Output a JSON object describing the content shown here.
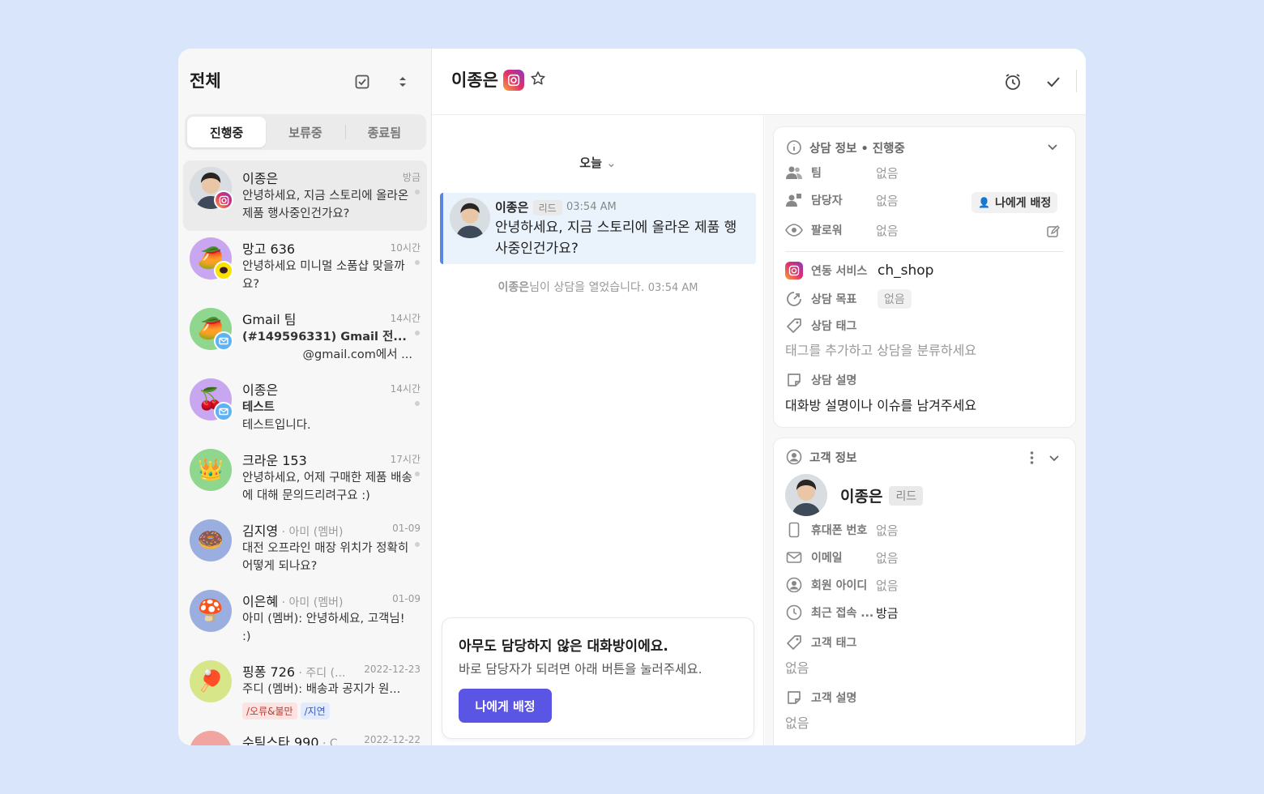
{
  "sidebar": {
    "title": "전체",
    "tabs": [
      "진행중",
      "보류중",
      "종료됨"
    ],
    "items": [
      {
        "name": "이종은",
        "sub": "",
        "time": "방금",
        "msg": "안녕하세요, 지금 스토리에 올라온 제품 행사중인건가요?",
        "avatar": "🧑",
        "channel": "instagram",
        "tags": []
      },
      {
        "name": "망고 636",
        "sub": "",
        "time": "10시간",
        "msg": "안녕하세요 미니멀 소품샵 맞을까요?",
        "avatar": "🥭",
        "channel": "kakao",
        "tags": []
      },
      {
        "name": "Gmail 팀",
        "sub": "",
        "time": "14시간",
        "msg_bold": "(#149596331) Gmail 전...",
        "msg": "@gmail.com에서 ...",
        "avatar": "🥭",
        "channel": "email",
        "tags": []
      },
      {
        "name": "이종은",
        "sub": "",
        "time": "14시간",
        "msg_bold": "테스트",
        "msg": "테스트입니다.",
        "avatar": "🍒",
        "channel": "email",
        "tags": []
      },
      {
        "name": "크라운 153",
        "sub": "",
        "time": "17시간",
        "msg": "안녕하세요, 어제 구매한 제품 배송에 대해 문의드리려구요 :)",
        "avatar": "👑",
        "channel": "",
        "tags": []
      },
      {
        "name": "김지영",
        "sub": " · 아미 (멤버)",
        "time": "01-09",
        "msg": "대전 오프라인 매장 위치가 정확히 어떻게 되나요?",
        "avatar": "🍩",
        "channel": "",
        "tags": []
      },
      {
        "name": "이은혜",
        "sub": " · 아미 (멤버)",
        "time": "01-09",
        "msg": "아미 (멤버): 안녕하세요, 고객님! :)",
        "avatar": "🍄",
        "channel": "",
        "tags": []
      },
      {
        "name": "핑퐁 726",
        "sub": " · 주디 (...",
        "time": "2022-12-23",
        "msg": "주디 (멤버): 배송과 공지가 원...",
        "avatar": "🏓",
        "channel": "",
        "tags": [
          "/오류&불만",
          "/지연"
        ]
      },
      {
        "name": "수틱스타 990",
        "sub": " · C...",
        "time": "2022-12-22",
        "msg": "",
        "avatar": "",
        "channel": "",
        "tags": []
      }
    ]
  },
  "header": {
    "name": "이종은"
  },
  "chat": {
    "date_label": "오늘",
    "message": {
      "author": "이종은",
      "role": "리드",
      "time": "03:54 AM",
      "text": "안녕하세요, 지금 스토리에 올라온 제품 행사중인건가요?"
    },
    "system_name": "이종은",
    "system_text": "님이 상담을 열었습니다.",
    "system_time": "03:54 AM",
    "cta": {
      "title": "아무도 담당하지 않은 대화방이에요.",
      "desc": "바로 담당자가 되려면 아래 버튼을 눌러주세요.",
      "button": "나에게 배정"
    }
  },
  "info": {
    "title": "상담 정보 • 진행중",
    "team_label": "팀",
    "team_value": "없음",
    "assignee_label": "담당자",
    "assignee_value": "없음",
    "assign_me": "나에게 배정",
    "follower_label": "팔로워",
    "follower_value": "없음",
    "service_label": "연동 서비스",
    "service_value": "ch_shop",
    "goal_label": "상담 목표",
    "goal_value": "없음",
    "tag_label": "상담 태그",
    "tag_placeholder": "태그를 추가하고 상담을 분류하세요",
    "desc_label": "상담 설명",
    "desc_placeholder": "대화방 설명이나 이슈를 남겨주세요"
  },
  "customer": {
    "title": "고객 정보",
    "name": "이종은",
    "role": "리드",
    "phone_label": "휴대폰 번호",
    "phone_value": "없음",
    "email_label": "이메일",
    "email_value": "없음",
    "member_label": "회원 아이디",
    "member_value": "없음",
    "recent_label": "최근 접속 ...",
    "recent_value": "방금",
    "tag_label": "고객 태그",
    "tag_value": "없음",
    "desc_label": "고객 설명",
    "desc_value": "없음"
  },
  "colors": {
    "accent": "#5b55e6",
    "msg_bg": "#eaf2fc",
    "msg_border": "#5b86e0",
    "page_bg": "#d8e5fb"
  }
}
